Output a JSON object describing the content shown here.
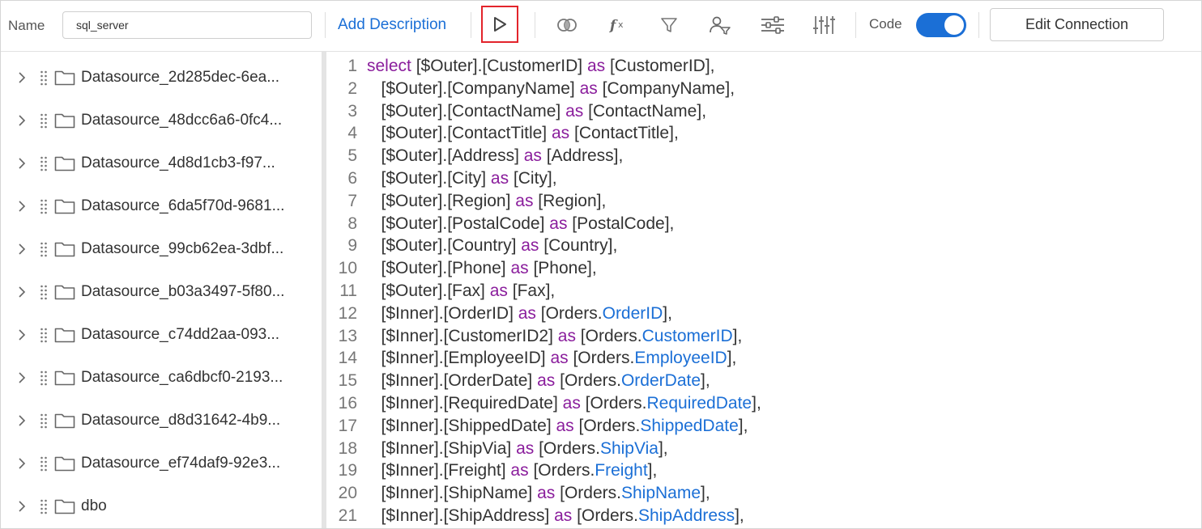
{
  "toolbar": {
    "name_label": "Name",
    "name_value": "sql_server",
    "add_description": "Add Description",
    "code_label": "Code",
    "code_toggle_on": true,
    "edit_connection": "Edit Connection",
    "icons": [
      "run-icon",
      "join-icon",
      "function-icon",
      "filter-icon",
      "user-filter-icon",
      "settings-sliders-icon",
      "adjust-icon"
    ],
    "accent_color": "#1b6fd6",
    "highlight_color": "#e3242b"
  },
  "sidebar": {
    "items": [
      {
        "label": "Datasource_2d285dec-6ea..."
      },
      {
        "label": "Datasource_48dcc6a6-0fc4..."
      },
      {
        "label": "Datasource_4d8d1cb3-f97..."
      },
      {
        "label": "Datasource_6da5f70d-9681..."
      },
      {
        "label": "Datasource_99cb62ea-3dbf..."
      },
      {
        "label": "Datasource_b03a3497-5f80..."
      },
      {
        "label": "Datasource_c74dd2aa-093..."
      },
      {
        "label": "Datasource_ca6dbcf0-2193..."
      },
      {
        "label": "Datasource_d8d31642-4b9..."
      },
      {
        "label": "Datasource_ef74daf9-92e3..."
      },
      {
        "label": "dbo"
      }
    ]
  },
  "editor": {
    "lines": [
      {
        "n": "1",
        "kw1": "select",
        "a": " [$Outer].[CustomerID] ",
        "kw2": "as",
        "b": " [CustomerID],",
        "c": "",
        "d": ""
      },
      {
        "n": "2",
        "kw1": "",
        "a": "   [$Outer].[CompanyName] ",
        "kw2": "as",
        "b": " [CompanyName],",
        "c": "",
        "d": ""
      },
      {
        "n": "3",
        "kw1": "",
        "a": "   [$Outer].[ContactName] ",
        "kw2": "as",
        "b": " [ContactName],",
        "c": "",
        "d": ""
      },
      {
        "n": "4",
        "kw1": "",
        "a": "   [$Outer].[ContactTitle] ",
        "kw2": "as",
        "b": " [ContactTitle],",
        "c": "",
        "d": ""
      },
      {
        "n": "5",
        "kw1": "",
        "a": "   [$Outer].[Address] ",
        "kw2": "as",
        "b": " [Address],",
        "c": "",
        "d": ""
      },
      {
        "n": "6",
        "kw1": "",
        "a": "   [$Outer].[City] ",
        "kw2": "as",
        "b": " [City],",
        "c": "",
        "d": ""
      },
      {
        "n": "7",
        "kw1": "",
        "a": "   [$Outer].[Region] ",
        "kw2": "as",
        "b": " [Region],",
        "c": "",
        "d": ""
      },
      {
        "n": "8",
        "kw1": "",
        "a": "   [$Outer].[PostalCode] ",
        "kw2": "as",
        "b": " [PostalCode],",
        "c": "",
        "d": ""
      },
      {
        "n": "9",
        "kw1": "",
        "a": "   [$Outer].[Country] ",
        "kw2": "as",
        "b": " [Country],",
        "c": "",
        "d": ""
      },
      {
        "n": "10",
        "kw1": "",
        "a": "   [$Outer].[Phone] ",
        "kw2": "as",
        "b": " [Phone],",
        "c": "",
        "d": ""
      },
      {
        "n": "11",
        "kw1": "",
        "a": "   [$Outer].[Fax] ",
        "kw2": "as",
        "b": " [Fax],",
        "c": "",
        "d": ""
      },
      {
        "n": "12",
        "kw1": "",
        "a": "   [$Inner].[OrderID] ",
        "kw2": "as",
        "b": " [Orders.",
        "c": "OrderID",
        "d": "],"
      },
      {
        "n": "13",
        "kw1": "",
        "a": "   [$Inner].[CustomerID2] ",
        "kw2": "as",
        "b": " [Orders.",
        "c": "CustomerID",
        "d": "],"
      },
      {
        "n": "14",
        "kw1": "",
        "a": "   [$Inner].[EmployeeID] ",
        "kw2": "as",
        "b": " [Orders.",
        "c": "EmployeeID",
        "d": "],"
      },
      {
        "n": "15",
        "kw1": "",
        "a": "   [$Inner].[OrderDate] ",
        "kw2": "as",
        "b": " [Orders.",
        "c": "OrderDate",
        "d": "],"
      },
      {
        "n": "16",
        "kw1": "",
        "a": "   [$Inner].[RequiredDate] ",
        "kw2": "as",
        "b": " [Orders.",
        "c": "RequiredDate",
        "d": "],"
      },
      {
        "n": "17",
        "kw1": "",
        "a": "   [$Inner].[ShippedDate] ",
        "kw2": "as",
        "b": " [Orders.",
        "c": "ShippedDate",
        "d": "],"
      },
      {
        "n": "18",
        "kw1": "",
        "a": "   [$Inner].[ShipVia] ",
        "kw2": "as",
        "b": " [Orders.",
        "c": "ShipVia",
        "d": "],"
      },
      {
        "n": "19",
        "kw1": "",
        "a": "   [$Inner].[Freight] ",
        "kw2": "as",
        "b": " [Orders.",
        "c": "Freight",
        "d": "],"
      },
      {
        "n": "20",
        "kw1": "",
        "a": "   [$Inner].[ShipName] ",
        "kw2": "as",
        "b": " [Orders.",
        "c": "ShipName",
        "d": "],"
      },
      {
        "n": "21",
        "kw1": "",
        "a": "   [$Inner].[ShipAddress] ",
        "kw2": "as",
        "b": " [Orders.",
        "c": "ShipAddress",
        "d": "],"
      }
    ]
  }
}
